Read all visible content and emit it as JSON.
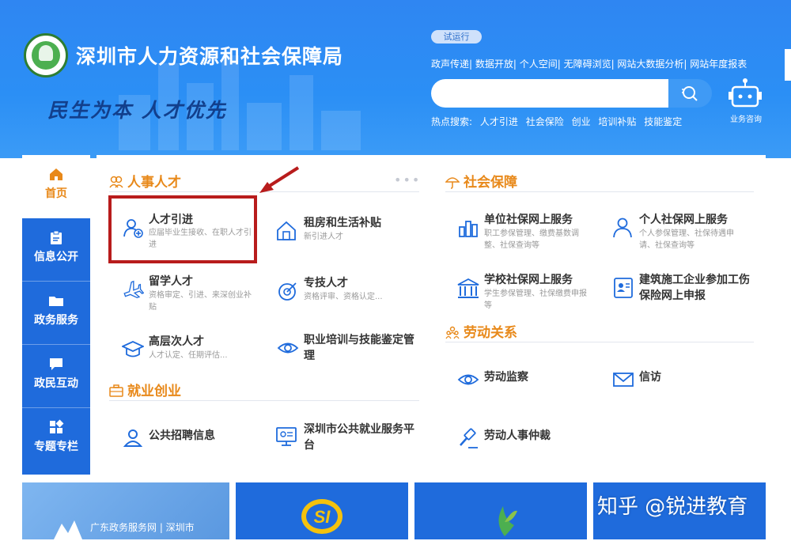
{
  "header": {
    "title": "深圳市人力资源和社会保障局",
    "slogan": "民生为本 人才优先",
    "trial_badge": "试运行",
    "top_links": "政声传递| 数据开放| 个人空间| 无障碍浏览| 网站大数据分析| 网站年度报表",
    "search": {
      "placeholder": "",
      "button_icon": "search-icon"
    },
    "hot_label": "热点搜索:",
    "hot_terms": [
      "人才引进",
      "社会保险",
      "创业",
      "培训补贴",
      "技能鉴定"
    ],
    "robot_label": "业务咨询",
    "brand_color": "#2b8ff5"
  },
  "nav": {
    "items": [
      {
        "label": "首页",
        "icon": "home-icon"
      },
      {
        "label": "信息公开",
        "icon": "clipboard-icon"
      },
      {
        "label": "政务服务",
        "icon": "folder-icon"
      },
      {
        "label": "政民互动",
        "icon": "chat-icon"
      },
      {
        "label": "专题专栏",
        "icon": "grid-icon"
      }
    ],
    "active_color": "#1f6bdc"
  },
  "sections": {
    "talent": {
      "title": "人事人才",
      "more": "•••",
      "items": [
        {
          "title": "人才引进",
          "desc": "应届毕业生接收、在职人才引进"
        },
        {
          "title": "租房和生活补贴",
          "desc": "新引进人才"
        },
        {
          "title": "留学人才",
          "desc": "资格审定、引进、来深创业补贴"
        },
        {
          "title": "专技人才",
          "desc": "资格评审、资格认定..."
        },
        {
          "title": "高层次人才",
          "desc": "人才认定、任期评估..."
        },
        {
          "title": "职业培训与技能鉴定管理",
          "desc": ""
        }
      ]
    },
    "employment": {
      "title": "就业创业",
      "items": [
        {
          "title": "公共招聘信息"
        },
        {
          "title": "深圳市公共就业服务平台"
        }
      ]
    },
    "social": {
      "title": "社会保障",
      "items": [
        {
          "title": "单位社保网上服务",
          "desc": "职工参保管理、缴费基数调整、社保查询等"
        },
        {
          "title": "个人社保网上服务",
          "desc": "个人参保管理、社保待遇申请、社保查询等"
        },
        {
          "title": "学校社保网上服务",
          "desc": "学生参保管理、社保缴费申报等"
        },
        {
          "title": "建筑施工企业参加工伤保险网上申报",
          "desc": ""
        }
      ]
    },
    "labor": {
      "title": "劳动关系",
      "items": [
        {
          "title": "劳动监察"
        },
        {
          "title": "信访"
        },
        {
          "title": "劳动人事仲裁"
        }
      ]
    },
    "accent_color": "#e8891a"
  },
  "tiles": {
    "tile1_label": "广东政务服务网 | 深圳市",
    "tile2_logo": "SI"
  },
  "watermark": "知乎 @锐进教育",
  "highlight_color": "#b81c1c"
}
